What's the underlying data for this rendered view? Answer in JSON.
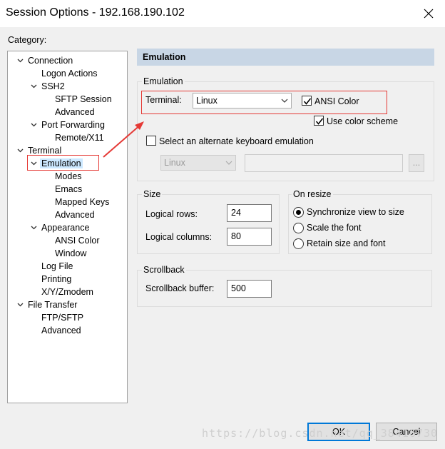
{
  "window": {
    "title": "Session Options - 192.168.190.102"
  },
  "category_label": "Category:",
  "tree": [
    {
      "label": "Connection",
      "expander": "v"
    },
    {
      "label": "Logon Actions",
      "expander": ""
    },
    {
      "label": "SSH2",
      "expander": "v"
    },
    {
      "label": "SFTP Session",
      "expander": ""
    },
    {
      "label": "Advanced",
      "expander": ""
    },
    {
      "label": "Port Forwarding",
      "expander": "v"
    },
    {
      "label": "Remote/X11",
      "expander": ""
    },
    {
      "label": "Terminal",
      "expander": "v"
    },
    {
      "label": "Emulation",
      "expander": "v",
      "selected": true
    },
    {
      "label": "Modes",
      "expander": ""
    },
    {
      "label": "Emacs",
      "expander": ""
    },
    {
      "label": "Mapped Keys",
      "expander": ""
    },
    {
      "label": "Advanced",
      "expander": ""
    },
    {
      "label": "Appearance",
      "expander": "v"
    },
    {
      "label": "ANSI Color",
      "expander": ""
    },
    {
      "label": "Window",
      "expander": ""
    },
    {
      "label": "Log File",
      "expander": ""
    },
    {
      "label": "Printing",
      "expander": ""
    },
    {
      "label": "X/Y/Zmodem",
      "expander": ""
    },
    {
      "label": "File Transfer",
      "expander": "v"
    },
    {
      "label": "FTP/SFTP",
      "expander": ""
    },
    {
      "label": "Advanced",
      "expander": ""
    }
  ],
  "panel_header": "Emulation",
  "emulation": {
    "group_title": "Emulation",
    "terminal_label": "Terminal:",
    "terminal_value": "Linux",
    "ansi_color_label": "ANSI Color",
    "ansi_color_checked": true,
    "use_color_scheme_label": "Use color scheme",
    "use_color_scheme_checked": true,
    "alternate_label": "Select an alternate keyboard emulation",
    "alternate_checked": false,
    "alternate_value": "Linux",
    "browse_label": "..."
  },
  "size": {
    "group_title": "Size",
    "rows_label": "Logical rows:",
    "rows_value": "24",
    "cols_label": "Logical columns:",
    "cols_value": "80"
  },
  "on_resize": {
    "group_title": "On resize",
    "options": [
      "Synchronize view to size",
      "Scale the font",
      "Retain size and font"
    ],
    "selected_index": 0
  },
  "scrollback": {
    "group_title": "Scrollback",
    "buffer_label": "Scrollback buffer:",
    "buffer_value": "500"
  },
  "buttons": {
    "ok": "OK",
    "cancel": "Cancel"
  },
  "watermark": "https://blog.csdn.net/qq_38416730",
  "colors": {
    "annotation_red": "#e53935",
    "selection": "#cce8ff",
    "header_bar": "#c8d6e5"
  }
}
